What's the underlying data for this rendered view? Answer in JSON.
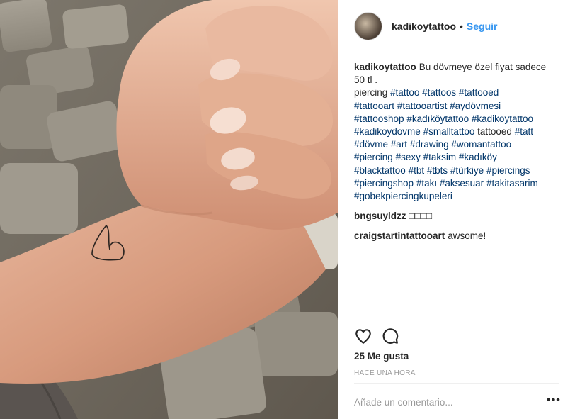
{
  "post": {
    "photo_alt": "",
    "author": {
      "username": "kadikoytattoo",
      "separator": "•",
      "follow_label": "Seguir"
    },
    "caption": {
      "username": "kadikoytattoo",
      "text_line1": "Bu dövmeye özel fiyat sadece",
      "text_line2": "50 tl .",
      "hashtag_lines": [
        "piercing #tattoo #tattoos #tattooed",
        "#tattooart #tattooartist #aydövmesi",
        "#tattooshop #kadıköytattoo #kadikoytattoo",
        "#kadikoydovme #smalltattoo tattooed #tatt",
        "#dövme #art #drawing #womantattoo",
        "#piercing #sexy #taksim #kadıköy",
        "#blacktattoo #tbt #tbts #türkiye #piercings",
        "#piercingshop #takı #aksesuar #takitasarim",
        "#gobekpiercingkupeleri"
      ]
    },
    "comments": [
      {
        "username": "bngsuyldzz",
        "text": "□□□□"
      },
      {
        "username": "craigstartintattooart",
        "text": "awsome!"
      }
    ],
    "actions": {
      "like_icon": "heart-outline-icon",
      "comment_icon": "speech-bubble-icon"
    },
    "likes_text": "25 Me gusta",
    "timestamp": "HACE UNA HORA",
    "comment_box": {
      "placeholder": "Añade un comentario...",
      "more_label": "•••"
    },
    "colors": {
      "link_blue": "#3897f0",
      "hashtag": "#003569",
      "text": "#262626",
      "muted": "#999999",
      "border": "#efefef"
    }
  }
}
